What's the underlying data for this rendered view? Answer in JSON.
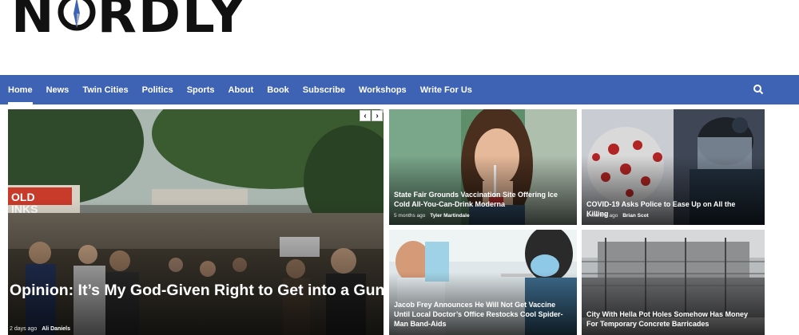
{
  "logo": {
    "left": "N",
    "right": "RDLY"
  },
  "nav": {
    "items": [
      "Home",
      "News",
      "Twin Cities",
      "Politics",
      "Sports",
      "About",
      "Book",
      "Subscribe",
      "Workshops",
      "Write For Us"
    ],
    "search_icon": "search-icon"
  },
  "colors": {
    "nav_bg": "#3f63b4",
    "text_on_image": "#ffffff"
  },
  "hero": {
    "title": "Opinion: It’s My God-Given Right to Get into a Gunfight on the Ferris Wheel at the State Fair",
    "time": "2 days ago",
    "author": "Ali Daniels",
    "prev_label": "‹",
    "next_label": "›"
  },
  "cards": [
    {
      "title": "State Fair Grounds Vaccination Site Offering Ice Cold All-You-Can-Drink Moderna",
      "time": "5 months ago",
      "author": "Tyler Martindale"
    },
    {
      "title": "COVID-19 Asks Police to Ease Up on All the Killing",
      "time": "5 months ago",
      "author": "Brian Scot"
    },
    {
      "title": "Jacob Frey Announces He Will Not Get Vaccine Until Local Doctor’s Office Restocks Cool Spider-Man Band-Aids",
      "time": "",
      "author": ""
    },
    {
      "title": "City With Hella Pot Holes Somehow Has Money For Temporary Concrete Barricades",
      "time": "",
      "author": ""
    }
  ]
}
